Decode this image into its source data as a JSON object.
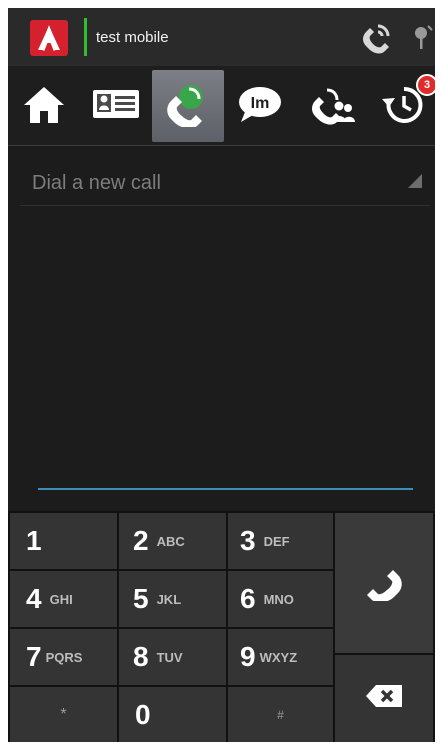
{
  "status_bar": {
    "account_name": "test mobile"
  },
  "nav": {
    "items": [
      {
        "name": "home",
        "icon": "home-icon"
      },
      {
        "name": "contacts",
        "icon": "contact-card-icon"
      },
      {
        "name": "dialer",
        "icon": "phone-icon",
        "active": true
      },
      {
        "name": "messages",
        "icon": "im-chat-icon"
      },
      {
        "name": "conference",
        "icon": "group-call-icon"
      },
      {
        "name": "history",
        "icon": "history-icon",
        "badge": "3"
      }
    ]
  },
  "dialer": {
    "placeholder": "Dial a new call"
  },
  "keypad": {
    "keys": [
      {
        "digit": "1",
        "letters": ""
      },
      {
        "digit": "2",
        "letters": "ABC"
      },
      {
        "digit": "3",
        "letters": "DEF"
      },
      {
        "digit": "4",
        "letters": "GHI"
      },
      {
        "digit": "5",
        "letters": "JKL"
      },
      {
        "digit": "6",
        "letters": "MNO"
      },
      {
        "digit": "7",
        "letters": "PQRS"
      },
      {
        "digit": "8",
        "letters": "TUV"
      },
      {
        "digit": "9",
        "letters": "WXYZ"
      },
      {
        "digit": "*",
        "letters": ""
      },
      {
        "digit": "0",
        "letters": ""
      },
      {
        "digit": "#",
        "letters": ""
      }
    ]
  },
  "colors": {
    "brand_red": "#d5202e",
    "accent_blue": "#3b8fb6",
    "status_green": "#2fbf2f"
  }
}
